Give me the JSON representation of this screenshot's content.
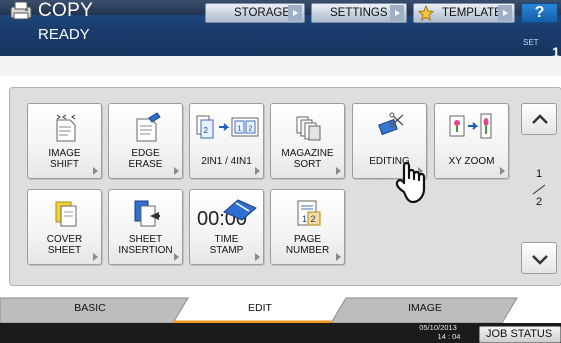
{
  "header": {
    "title": "COPY",
    "status": "READY",
    "buttons": {
      "storage": "STORAGE",
      "settings": "SETTINGS",
      "template": "TEMPLATE",
      "help": "?"
    },
    "set_label": "SET",
    "set_value": "1"
  },
  "functions": [
    {
      "label": "IMAGE\nSHIFT",
      "icon": "image-shift-icon"
    },
    {
      "label": "EDGE\nERASE",
      "icon": "edge-erase-icon"
    },
    {
      "label": "2IN1 / 4IN1",
      "icon": "2in1-4in1-icon"
    },
    {
      "label": "MAGAZINE\nSORT",
      "icon": "magazine-sort-icon"
    },
    {
      "label": "EDITING",
      "icon": "editing-icon"
    },
    {
      "label": "XY ZOOM",
      "icon": "xy-zoom-icon"
    },
    {
      "label": "COVER\nSHEET",
      "icon": "cover-sheet-icon"
    },
    {
      "label": "SHEET\nINSERTION",
      "icon": "sheet-insertion-icon"
    },
    {
      "label": "TIME\nSTAMP",
      "icon": "time-stamp-icon"
    },
    {
      "label": "PAGE\nNUMBER",
      "icon": "page-number-icon"
    }
  ],
  "pager": {
    "current": "1",
    "total": "2"
  },
  "tabs": [
    {
      "label": "BASIC",
      "active": false
    },
    {
      "label": "EDIT",
      "active": true
    },
    {
      "label": "IMAGE",
      "active": false
    }
  ],
  "footer": {
    "date": "05/10/2013",
    "time": "14 : 04",
    "job_status": "JOB STATUS"
  },
  "colors": {
    "header_bg": "#1a3c6c",
    "active_tab_accent": "#f39a1e",
    "help_button": "#1a6fc0"
  }
}
